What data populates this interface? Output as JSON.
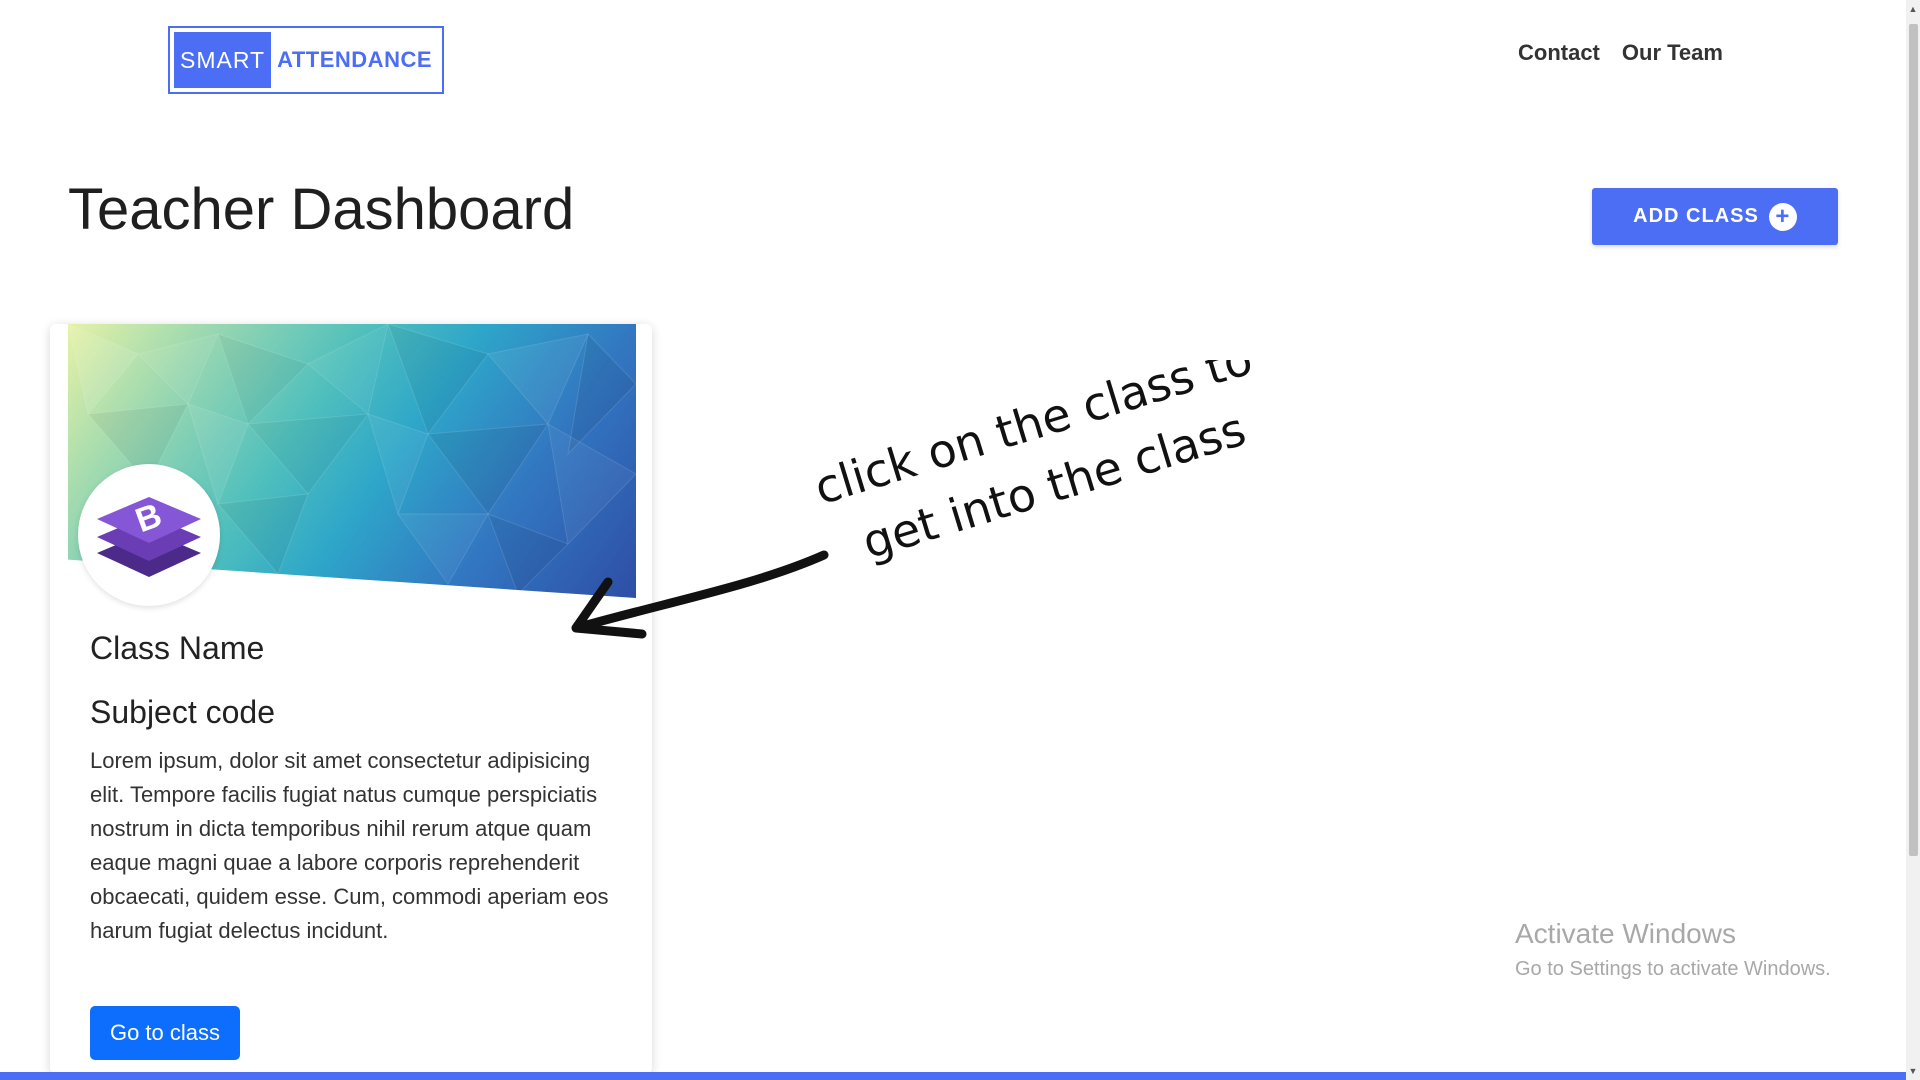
{
  "logo": {
    "smart": "SMART",
    "attendance": "ATTENDANCE"
  },
  "nav": {
    "contact": "Contact",
    "team": "Our Team"
  },
  "page": {
    "title": "Teacher Dashboard"
  },
  "actions": {
    "add_class": "ADD CLASS",
    "add_icon": "plus-circle-icon"
  },
  "card": {
    "class_name": "Class Name",
    "subject_code": "Subject code",
    "description": "Lorem ipsum, dolor sit amet consectetur adipisicing elit. Tempore facilis fugiat natus cumque perspiciatis nostrum in dicta temporibus nihil rerum atque quam eaque magni quae a labore corporis reprehenderit obcaecati, quidem esse. Cum, commodi aperiam eos harum fugiat delectus incidunt.",
    "button": "Go to class",
    "avatar_icon": "bootstrap-logo-icon"
  },
  "annotation": {
    "line1": "click on the class to",
    "line2": "get into the class"
  },
  "watermark": {
    "title": "Activate Windows",
    "subtitle": "Go to Settings to activate Windows."
  },
  "colors": {
    "brand": "#4c6ef5",
    "button": "#0d6efd",
    "bootstrap_purple": "#7952b3"
  }
}
